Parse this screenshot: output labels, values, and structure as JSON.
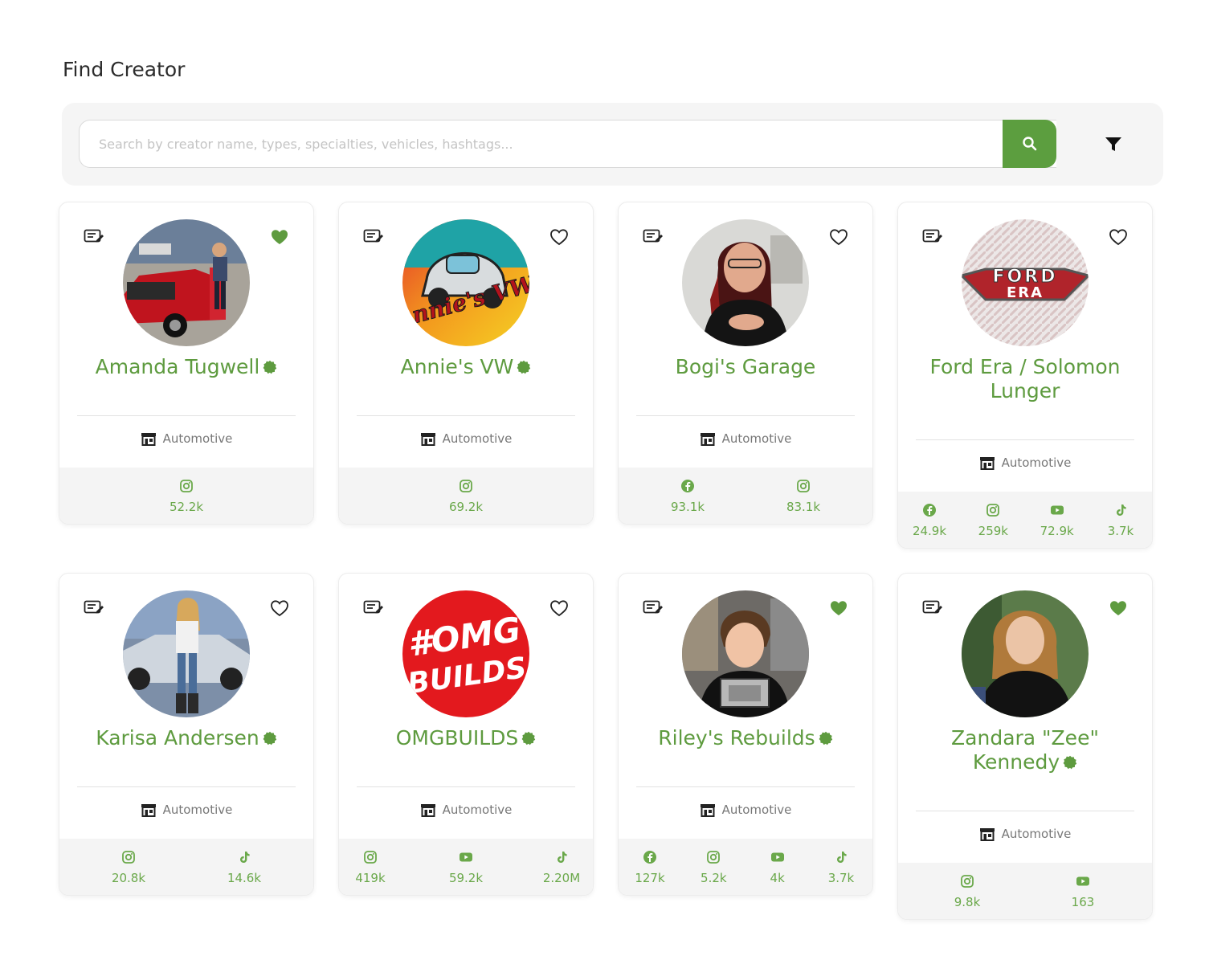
{
  "page": {
    "title": "Find Creator"
  },
  "search": {
    "placeholder": "Search by creator name, types, specialties, vehicles, hashtags...",
    "button_icon": "search-icon",
    "filter_icon": "filter-icon"
  },
  "colors": {
    "accent": "#5c9e3f",
    "name": "#5e9b3f",
    "stat": "#6aa84a"
  },
  "creators": [
    {
      "name": "Amanda Tugwell",
      "verified": true,
      "favorited": true,
      "category": "Automotive",
      "socials": [
        {
          "platform": "instagram",
          "count": "52.2k"
        }
      ]
    },
    {
      "name": "Annie's VW",
      "verified": true,
      "favorited": false,
      "category": "Automotive",
      "socials": [
        {
          "platform": "instagram",
          "count": "69.2k"
        }
      ]
    },
    {
      "name": "Bogi's Garage",
      "verified": false,
      "favorited": false,
      "category": "Automotive",
      "socials": [
        {
          "platform": "facebook",
          "count": "93.1k"
        },
        {
          "platform": "instagram",
          "count": "83.1k"
        }
      ]
    },
    {
      "name": "Ford Era / Solomon Lunger",
      "verified": false,
      "favorited": false,
      "category": "Automotive",
      "socials": [
        {
          "platform": "facebook",
          "count": "24.9k"
        },
        {
          "platform": "instagram",
          "count": "259k"
        },
        {
          "platform": "youtube",
          "count": "72.9k"
        },
        {
          "platform": "tiktok",
          "count": "3.7k"
        }
      ]
    },
    {
      "name": "Karisa Andersen",
      "verified": true,
      "favorited": false,
      "category": "Automotive",
      "socials": [
        {
          "platform": "instagram",
          "count": "20.8k"
        },
        {
          "platform": "tiktok",
          "count": "14.6k"
        }
      ]
    },
    {
      "name": "OMGBUILDS",
      "verified": true,
      "favorited": false,
      "category": "Automotive",
      "socials": [
        {
          "platform": "instagram",
          "count": "419k"
        },
        {
          "platform": "youtube",
          "count": "59.2k"
        },
        {
          "platform": "tiktok",
          "count": "2.20M"
        }
      ]
    },
    {
      "name": "Riley's Rebuilds",
      "verified": true,
      "favorited": true,
      "category": "Automotive",
      "socials": [
        {
          "platform": "facebook",
          "count": "127k"
        },
        {
          "platform": "instagram",
          "count": "5.2k"
        },
        {
          "platform": "youtube",
          "count": "4k"
        },
        {
          "platform": "tiktok",
          "count": "3.7k"
        }
      ]
    },
    {
      "name": "Zandara \"Zee\" Kennedy",
      "verified": true,
      "favorited": true,
      "category": "Automotive",
      "socials": [
        {
          "platform": "instagram",
          "count": "9.8k"
        },
        {
          "platform": "youtube",
          "count": "163"
        }
      ]
    }
  ],
  "avatar_logos": {
    "annies_vw": "Annie's VW",
    "ford_era_top": "FORD",
    "ford_era_bottom": "ERA",
    "omgbuilds_top": "#OMG",
    "omgbuilds_bottom": "BUILDS"
  }
}
